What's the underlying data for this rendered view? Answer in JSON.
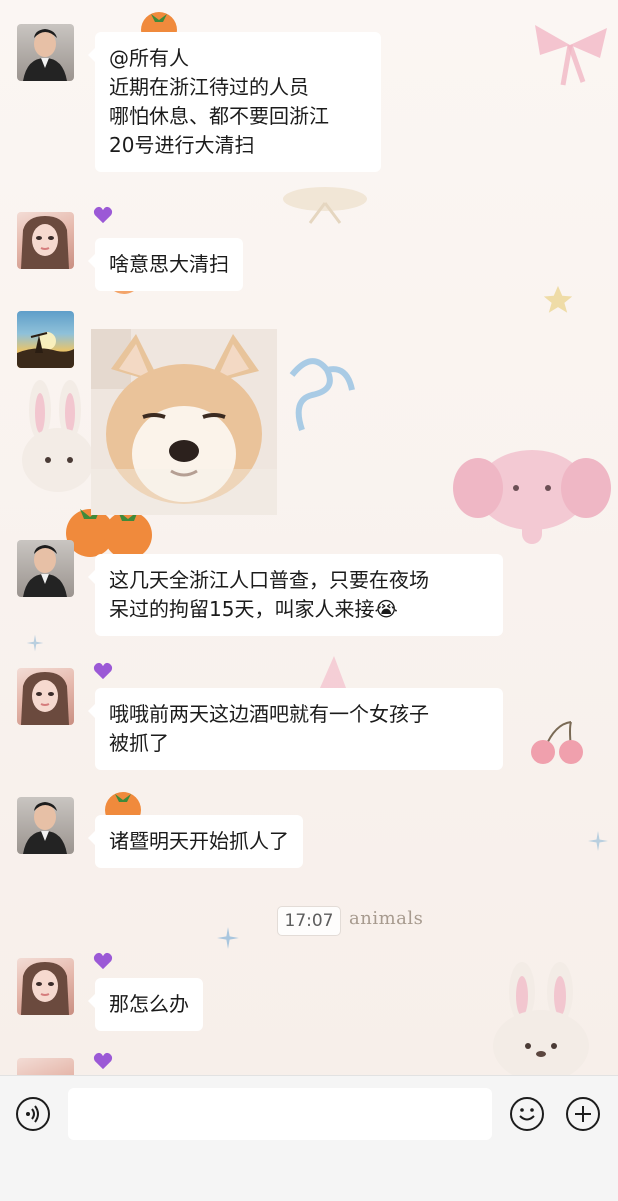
{
  "chat": {
    "messages": [
      {
        "sender": "man",
        "text": "@所有人\n近期在浙江待过的人员\n哪怕休息、都不要回浙江\n20号进行大清扫"
      },
      {
        "sender": "girl",
        "text": "啥意思大清扫"
      },
      {
        "sender": "sky",
        "sticker": "dog-sticker"
      },
      {
        "sender": "man",
        "text": "这几天全浙江人口普查，只要在夜场\n呆过的拘留15天，叫家人来接😭"
      },
      {
        "sender": "girl",
        "text": "哦哦前两天这边酒吧就有一个女孩子\n被抓了"
      },
      {
        "sender": "man",
        "text": "诸暨明天开始抓人了"
      },
      {
        "sender": "girl",
        "text": "那怎么办"
      }
    ],
    "timestamp": "17:07",
    "wallpaper_text": "animals"
  },
  "bottom_bar": {
    "voice_icon": "voice-icon",
    "emoji_icon": "emoji-icon",
    "plus_icon": "plus-icon",
    "input_value": ""
  },
  "colors": {
    "bubble": "#ffffff",
    "badge": "#9b59d6",
    "background": "#f8f2ee"
  }
}
